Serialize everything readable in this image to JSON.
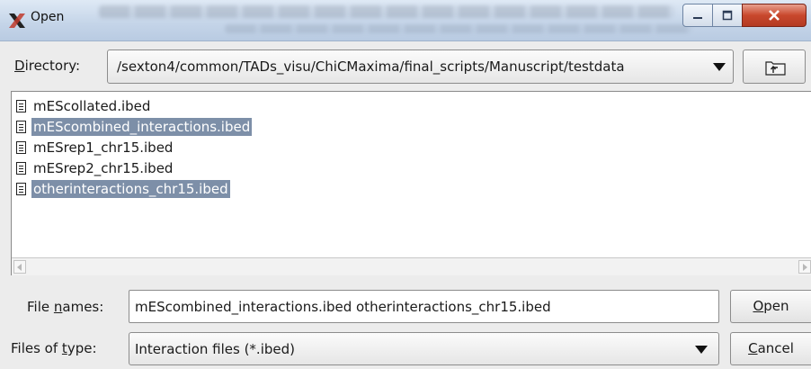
{
  "window": {
    "title": "Open",
    "app_icon": "x-logo-icon",
    "controls": [
      "minimize-icon",
      "maximize-icon",
      "close-icon"
    ]
  },
  "directory": {
    "label_mnemonic": "D",
    "label_rest": "irectory:",
    "path": "/sexton4/common/TADs_visu/ChiCMaxima/final_scripts/Manuscript/testdata",
    "up_icon": "folder-up-icon"
  },
  "files": [
    {
      "name": "mEScollated.ibed",
      "selected": false
    },
    {
      "name": "mEScombined_interactions.ibed",
      "selected": true
    },
    {
      "name": "mESrep1_chr15.ibed",
      "selected": false
    },
    {
      "name": "mESrep2_chr15.ibed",
      "selected": false
    },
    {
      "name": "otherinteractions_chr15.ibed",
      "selected": true
    }
  ],
  "file_names": {
    "label_pre": "File ",
    "label_mnemonic": "n",
    "label_post": "ames:",
    "value": "mEScombined_interactions.ibed otherinteractions_chr15.ibed"
  },
  "files_of_type": {
    "label_pre": "Files of ",
    "label_mnemonic": "t",
    "label_post": "ype:",
    "value": "Interaction files (*.ibed)"
  },
  "buttons": {
    "open_mnemonic": "O",
    "open_rest": "pen",
    "cancel_mnemonic": "C",
    "cancel_rest": "ancel"
  },
  "colors": {
    "selection": "#7d8fa8",
    "title_bar": "#c4d4e8",
    "close_button": "#c9482d"
  }
}
